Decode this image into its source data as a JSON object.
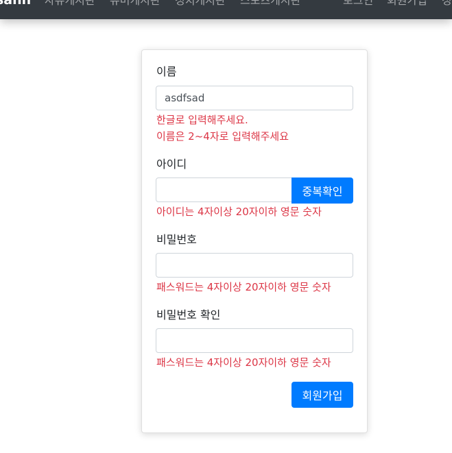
{
  "navbar": {
    "brand": "sanh",
    "links": [
      "자유게시판",
      "유머게시판",
      "정치게시판",
      "스포츠게시판"
    ],
    "right_links": [
      "로그인",
      "회원가입",
      "정"
    ]
  },
  "form": {
    "name": {
      "label": "이름",
      "value": "asdfsad",
      "errors": [
        "한글로 입력해주세요.",
        "이름은 2~4자로 입력해주세요"
      ]
    },
    "userid": {
      "label": "아이디",
      "value": "",
      "check_button": "중복확인",
      "error": "아이디는 4자이상 20자이하 영문 숫자"
    },
    "password": {
      "label": "비밀번호",
      "value": "",
      "error": "패스워드는 4자이상 20자이하 영문 숫자"
    },
    "password_confirm": {
      "label": "비밀번호 확인",
      "value": "",
      "error": "패스워드는 4자이상 20자이하 영문 숫자"
    },
    "submit_label": "회원가입"
  },
  "colors": {
    "navbar_bg": "#343a40",
    "primary": "#007bff",
    "error": "#dc3545"
  }
}
